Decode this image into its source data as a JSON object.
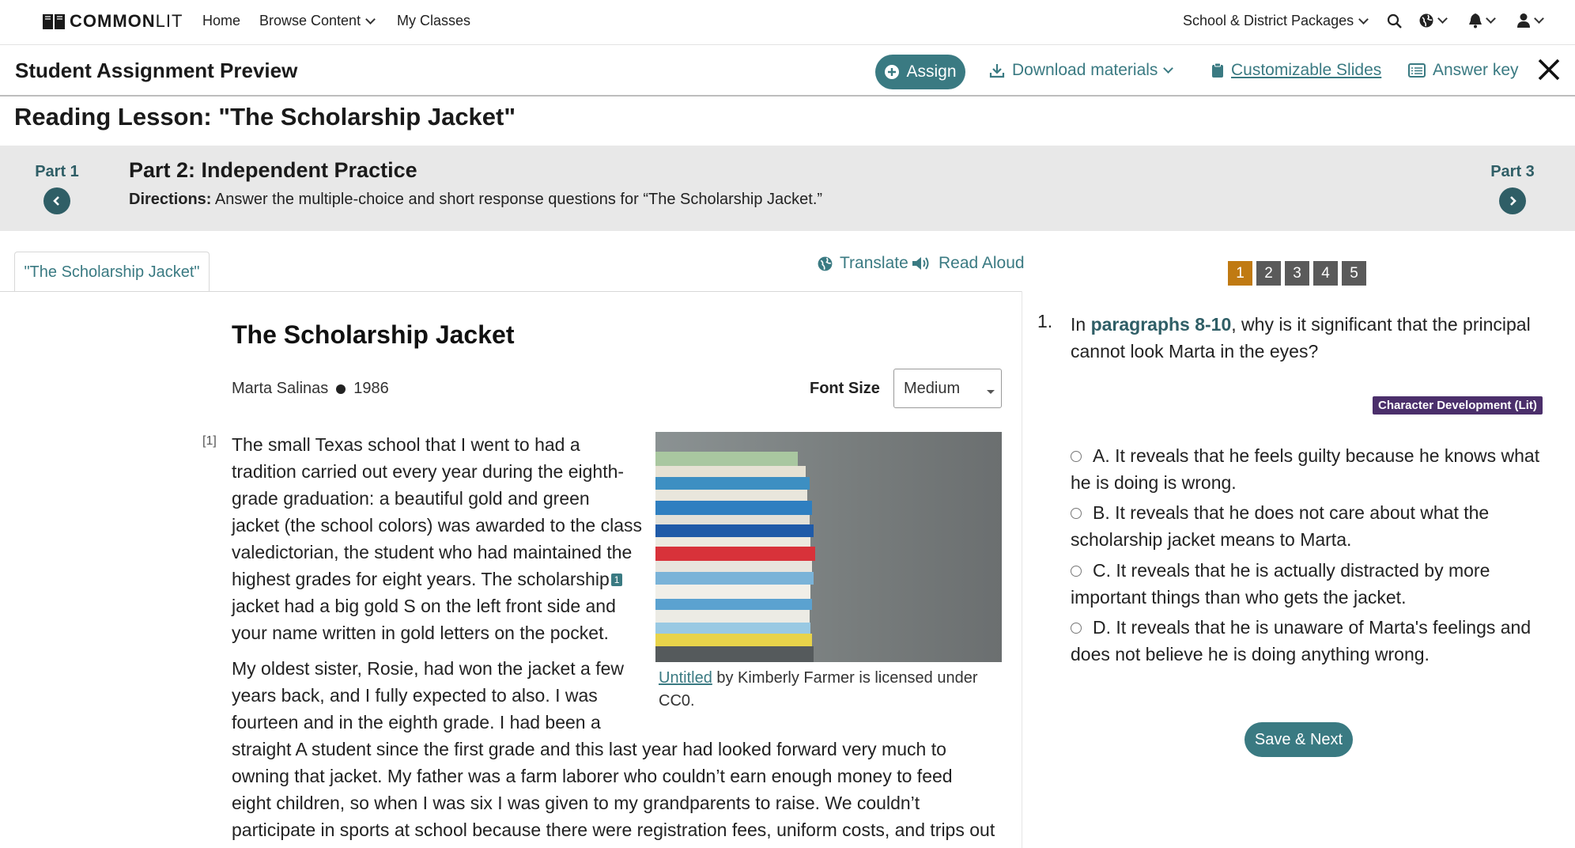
{
  "nav": {
    "logo_bold": "COMMON",
    "logo_light": "LIT",
    "home": "Home",
    "browse": "Browse Content",
    "classes": "My Classes",
    "packages": "School & District Packages"
  },
  "toolbar": {
    "title": "Student Assignment Preview",
    "assign": "Assign",
    "download": "Download materials",
    "slides": "Customizable Slides",
    "answer_key": "Answer key"
  },
  "lesson": {
    "title": "Reading Lesson: \"The Scholarship Jacket\""
  },
  "parts": {
    "prev": "Part 1",
    "next": "Part 3",
    "current_title": "Part 2: Independent Practice",
    "directions_label": "Directions:",
    "directions_text": " Answer the multiple-choice and short response questions for “The Scholarship Jacket.”"
  },
  "reading": {
    "tab": "\"The Scholarship Jacket\"",
    "translate": "Translate",
    "read_aloud": "Read Aloud",
    "title": "The Scholarship Jacket",
    "author": "Marta Salinas",
    "year": "1986",
    "font_size_label": "Font Size",
    "font_size_value": "Medium",
    "para_number": "[1]",
    "p1_lines": [
      "The small Texas school that I went to had a",
      "tradition carried out every year during the eighth-",
      "grade graduation: a beautiful gold and green",
      "jacket (the school colors) was awarded to the class",
      "valedictorian, the student who had maintained the",
      "highest grades for eight years. The scholarship",
      "jacket had a big gold S on the left front side and",
      "your name written in gold letters on the pocket."
    ],
    "footnote": "1",
    "p2_lines_narrow": [
      "My oldest sister, Rosie, had won the jacket a few",
      "years back, and I fully expected to also. I was",
      "fourteen and in the eighth grade. I had been a"
    ],
    "p2_lines_wide": [
      "straight A student since the first grade and this last year had looked forward very much to",
      "owning that jacket. My father was a farm laborer who couldn’t earn enough money to feed",
      "eight children, so when I was six I was given to my grandparents to raise. We couldn’t",
      "participate in sports at school because there were registration fees, uniform costs, and trips out"
    ],
    "caption_link": "Untitled",
    "caption_text": " by Kimberly Farmer is licensed under CC0."
  },
  "question": {
    "pages": [
      "1",
      "2",
      "3",
      "4",
      "5"
    ],
    "number": "1.",
    "text_before": "In ",
    "text_ref": "paragraphs 8-10",
    "text_after": ", why is it significant that the principal cannot look Marta in the eyes?",
    "tag": "Character Development (Lit)",
    "options": [
      "A. It reveals that he feels guilty because he knows what he is doing is wrong.",
      "B. It reveals that he does not care about what the scholarship jacket means to Marta.",
      "C. It reveals that he is actually distracted by more important things than who gets the jacket.",
      "D. It reveals that he is unaware of Marta's feelings and does not believe he is doing anything wrong."
    ],
    "save": "Save & Next"
  },
  "colors": {
    "accent": "#3a7a82",
    "part_nav": "#2f5e66",
    "active_page": "#c07a12",
    "tag_bg": "#4b2f6b"
  }
}
